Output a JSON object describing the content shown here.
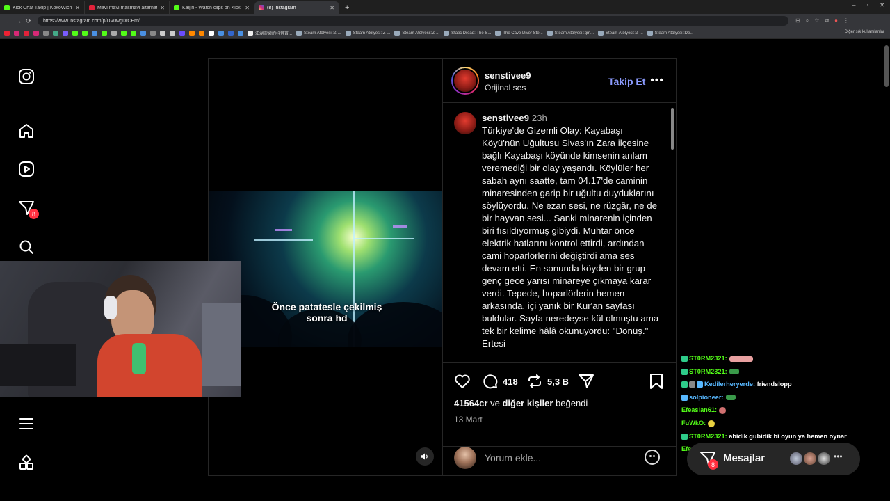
{
  "browser": {
    "tabs": [
      {
        "label": "Kick Chat Takip | KokoWich",
        "active": false
      },
      {
        "label": "Mavi mavi masmavi alternatif link",
        "active": false
      },
      {
        "label": "Kaijiri - Watch clips on Kick",
        "active": false
      },
      {
        "label": "(8) Instagram",
        "active": true
      }
    ],
    "new_tab": "+",
    "window_controls": [
      "–",
      "▫",
      "✕"
    ],
    "url": "https://www.instagram.com/p/DV0wgDrCEm/",
    "bookmarks": [
      "江湖霊梁的抖音首...",
      "Steam Atölyesi::Z-...",
      "Steam Atölyesi::Z-...",
      "Steam Atölyesi::Z-...",
      "Static Dread: The S...",
      "The Cave Diver Ste...",
      "Steam Atölyesi::gm...",
      "Steam Atölyesi::Z-...",
      "Steam Atölyesi::De..."
    ],
    "bookmarks_other": "Diğer sık kullanılanlar"
  },
  "sidebar": {
    "notification_count": "8"
  },
  "reel": {
    "caption": "Önce patatesle çekilmiş sonra hd"
  },
  "post": {
    "username": "senstivee9",
    "audio": "Orijinal ses",
    "follow_label": "Takip Et",
    "more_label": "•••",
    "caption_user": "senstivee9",
    "caption_time": "23h",
    "caption_text": "Türkiye'de Gizemli Olay: Kayabaşı Köyü'nün Uğultusu Sivas'ın Zara ilçesine bağlı Kayabaşı köyünde kimsenin anlam veremediği bir olay yaşandı. Köylüler her sabah aynı saatte, tam 04.17'de caminin minaresinden garip bir uğultu duyduklarını söylüyordu. Ne ezan sesi, ne rüzgâr, ne de bir hayvan sesi... Sanki minarenin içinden biri fısıldıyormuş gibiydi. Muhtar önce elektrik hatlarını kontrol ettirdi, ardından cami hoparlörlerini değiştirdi ama ses devam etti. En sonunda köyden bir grup genç gece yarısı minareye çıkmaya karar verdi. Tepede, hoparlörlerin hemen arkasında, içi yanık bir Kur'an sayfası buldular. Sayfa neredeyse kül olmuştu ama tek bir kelime hâlâ okunuyordu: \"Dönüş.\" Ertesi",
    "comments_count": "418",
    "reposts_count": "5,3 B",
    "likes_user": "41564cr",
    "likes_and": "ve",
    "likes_others": "diğer kişiler",
    "likes_suffix": "beğendi",
    "date": "13 Mart",
    "comment_placeholder": "Yorum ekle..."
  },
  "chat": {
    "lines": [
      {
        "user": "ST0RM2321:",
        "msg": "",
        "emote": "#e8a0a0"
      },
      {
        "user": "ST0RM2321:",
        "msg": "",
        "emote": "#3a9a4a"
      },
      {
        "user": "Kedilerheryerde:",
        "msg": "friendslopp",
        "emote": ""
      },
      {
        "user": "solpioneer:",
        "msg": "",
        "emote": "#3a9a4a"
      },
      {
        "user": "Efeaslan61:",
        "msg": "",
        "emote": "#d07070"
      },
      {
        "user": "FuWkO:",
        "msg": "",
        "emote": "#e8d040"
      },
      {
        "user": "ST0RM2321:",
        "msg": "abidik gubidik bi oyun ya hemen oynar",
        "emote": ""
      },
      {
        "user": "Efeaslan61:",
        "msg": "",
        "emote": "#806050"
      }
    ]
  },
  "messages": {
    "label": "Mesajlar",
    "badge": "8",
    "more": "•••"
  }
}
